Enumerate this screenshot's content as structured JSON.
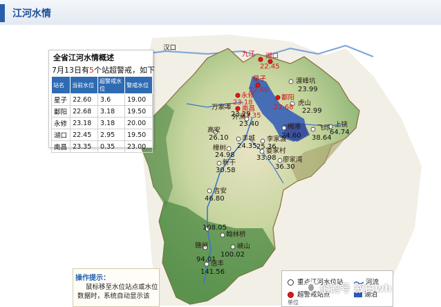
{
  "header": {
    "title": "江河水情"
  },
  "map": {
    "outside_labels": {
      "hankou": "汉口"
    },
    "colors": {
      "red_station": "#d81b1b",
      "white_station": "#ffffff",
      "lake": "#2f59b8"
    }
  },
  "overview": {
    "title": "全省江河水情概述",
    "subtitle_pre": "7月13日有",
    "subtitle_num": "5",
    "subtitle_post": "个站超警戒，如下",
    "headers": [
      "站名",
      "当前水位",
      "超警戒水位",
      "警戒水位"
    ],
    "rows": [
      [
        "星子",
        "22.60",
        "3.6",
        "19.00"
      ],
      [
        "鄱阳",
        "22.68",
        "3.18",
        "19.50"
      ],
      [
        "永修",
        "23.18",
        "3.18",
        "20.00"
      ],
      [
        "湖口",
        "22.45",
        "2.95",
        "19.50"
      ],
      [
        "南昌",
        "23.35",
        "0.35",
        "23.00"
      ]
    ]
  },
  "stations": [
    {
      "name": "九江",
      "value": "",
      "alert": true
    },
    {
      "name": "湖口",
      "value": "22.45",
      "alert": true
    },
    {
      "name": "星子",
      "value": "22.60",
      "alert": true
    },
    {
      "name": "永修",
      "value": "23.18",
      "alert": true
    },
    {
      "name": "鄱阳",
      "value": "22.68",
      "alert": true
    },
    {
      "name": "南昌",
      "value": "23.35",
      "alert": true
    },
    {
      "name": "渡峰坑",
      "value": "23.99",
      "alert": false
    },
    {
      "name": "虎山",
      "value": "22.99",
      "alert": false
    },
    {
      "name": "万家埠",
      "value": "23.29",
      "alert": false
    },
    {
      "name": "外洲",
      "value": "23.40",
      "alert": false
    },
    {
      "name": "梅港",
      "value": "24.60",
      "alert": false
    },
    {
      "name": "飞印",
      "value": "38.64",
      "alert": false
    },
    {
      "name": "上饶",
      "value": "64.74",
      "alert": false
    },
    {
      "name": "高安",
      "value": "26.10",
      "alert": false
    },
    {
      "name": "丰城",
      "value": "24.35",
      "alert": false
    },
    {
      "name": "李家渡",
      "value": "25.36",
      "alert": false
    },
    {
      "name": "娄家村",
      "value": "33.98",
      "alert": false
    },
    {
      "name": "樟树",
      "value": "24.98",
      "alert": false
    },
    {
      "name": "廖家湾",
      "value": "36.30",
      "alert": false
    },
    {
      "name": "新干",
      "value": "30.58",
      "alert": false
    },
    {
      "name": "吉安",
      "value": "46.80",
      "alert": false
    },
    {
      "name": "栋背",
      "value": "108.05",
      "alert": false
    },
    {
      "name": "翰林桥",
      "value": "",
      "alert": false
    },
    {
      "name": "赣州",
      "value": "94.01",
      "alert": false
    },
    {
      "name": "峡山",
      "value": "100.02",
      "alert": false
    },
    {
      "name": "信丰",
      "value": "141.56",
      "alert": false
    }
  ],
  "help": {
    "title": "操作提示：",
    "body": "鼠标移至水位站点或水位数据时，系统自动显示该"
  },
  "legend": {
    "key_station": "重点江河水位站",
    "river": "河流",
    "alert_station": "超警戒站点",
    "lake": "湖泊",
    "unit": "单位"
  },
  "watermark": "企鹅号 叙白wh"
}
